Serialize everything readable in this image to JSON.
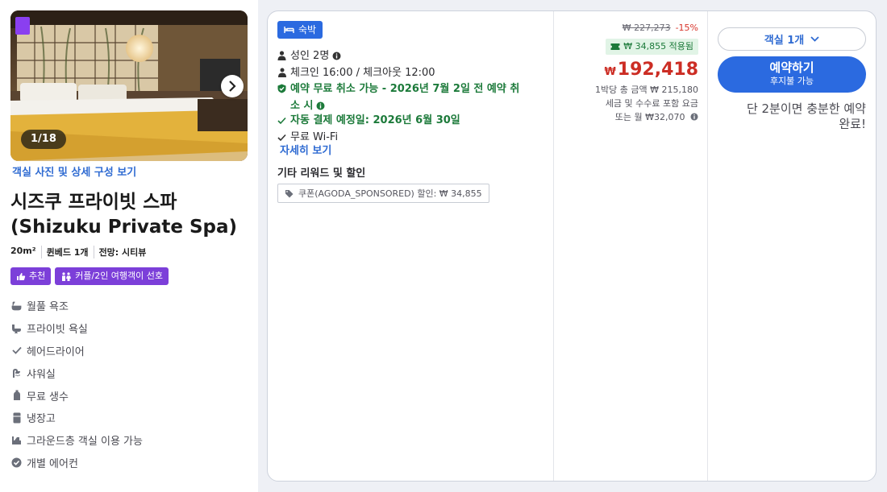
{
  "room": {
    "photo_counter": "1/18",
    "photos_link": "객실 사진 및 상세 구성 보기",
    "title_line1": "시즈쿠 프라이빗 스파",
    "title_line2": "(Shizuku Private Spa)",
    "specs": [
      "20m²",
      "퀸베드 1개",
      "전망: 시티뷰"
    ],
    "badges": [
      {
        "label": "추천",
        "icon": "thumbs-up-icon"
      },
      {
        "label": "커플/2인 여행객이 선호",
        "icon": "couple-icon"
      }
    ],
    "amenities": [
      {
        "label": "월풀 욕조",
        "icon": "bathtub-icon"
      },
      {
        "label": "프라이빗 욕실",
        "icon": "private-bathroom-icon"
      },
      {
        "label": "헤어드라이어",
        "icon": "checkmark-icon"
      },
      {
        "label": "샤워실",
        "icon": "shower-icon"
      },
      {
        "label": "무료 생수",
        "icon": "water-bottle-icon"
      },
      {
        "label": "냉장고",
        "icon": "fridge-icon"
      },
      {
        "label": "그라운드층 객실 이용 가능",
        "icon": "ground-floor-icon"
      },
      {
        "label": "개별 에어컨",
        "icon": "aircon-check-icon"
      }
    ]
  },
  "offer": {
    "stay_badge": "숙박",
    "adults": "성인 2명",
    "checkin": "체크인 16:00 / 체크아웃 12:00",
    "free_cancel_line1": "예약 무료 취소 가능 - 2026년 7월 2일 전 예약 취",
    "free_cancel_line2": "소 시",
    "auto_payment": "자동 결제 예정일: 2026년 6월 30일",
    "wifi": "무료 Wi-Fi",
    "more_link": "자세히 보기",
    "rewards_title": "기타 리워드 및 할인",
    "coupon": "쿠폰(AGODA_SPONSORED) 할인: ₩ 34,855"
  },
  "pricing": {
    "original_price": "₩ 227,273",
    "discount_pct": "-15%",
    "coupon_applied": "₩ 34,855 적용됨",
    "currency_symbol": "₩",
    "price": "192,418",
    "per_night_total": "1박당 총 금액 ₩ 215,180",
    "taxes_note": "세금 및 수수료 포함 요금",
    "monthly": "또는 월 ₩32,070"
  },
  "booking": {
    "rooms_select": "객실 1개",
    "book_label": "예약하기",
    "book_sublabel": "후지불 가능",
    "urgency_line1": "단 2분이면 충분한 예약",
    "urgency_line2": "완료!"
  },
  "colors": {
    "accent_blue": "#2b6ae0",
    "badge_purple": "#7c3fd9",
    "price_red": "#cc2d24",
    "success_green": "#1c7a3a"
  }
}
